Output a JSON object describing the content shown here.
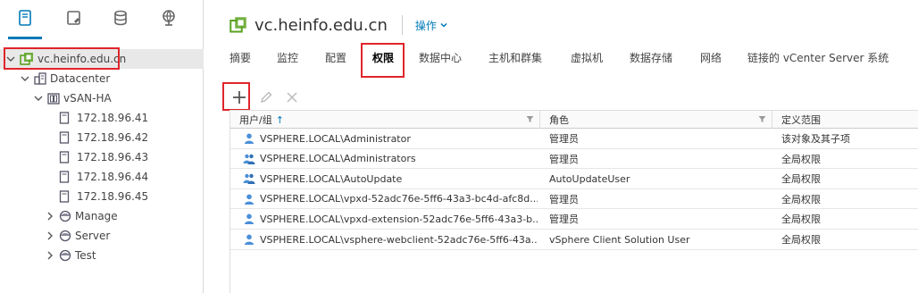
{
  "left_tabs": [
    {
      "name": "hosts-and-clusters-icon"
    },
    {
      "name": "vms-and-templates-icon"
    },
    {
      "name": "storage-icon"
    },
    {
      "name": "networking-icon"
    }
  ],
  "tree": {
    "root": "vc.heinfo.edu.cn",
    "datacenter": "Datacenter",
    "cluster": "vSAN-HA",
    "hosts": [
      "172.18.96.41",
      "172.18.96.42",
      "172.18.96.43",
      "172.18.96.44",
      "172.18.96.45"
    ],
    "vapps": [
      "Manage",
      "Server",
      "Test"
    ]
  },
  "header": {
    "title": "vc.heinfo.edu.cn",
    "actions_label": "操作"
  },
  "tabs": [
    "摘要",
    "监控",
    "配置",
    "权限",
    "数据中心",
    "主机和群集",
    "虚拟机",
    "数据存储",
    "网络",
    "链接的 vCenter Server 系统"
  ],
  "active_tab": "权限",
  "toolbar": {
    "add_icon": "plus-icon",
    "edit_icon": "pencil-icon",
    "delete_icon": "close-icon"
  },
  "grid": {
    "columns": [
      "用户/组",
      "角色",
      "定义范围"
    ],
    "sort_indicator": "↑",
    "rows": [
      {
        "user": "VSPHERE.LOCAL\\Administrator",
        "role": "管理员",
        "scope": "该对象及其子项",
        "type": "user"
      },
      {
        "user": "VSPHERE.LOCAL\\Administrators",
        "role": "管理员",
        "scope": "全局权限",
        "type": "group"
      },
      {
        "user": "VSPHERE.LOCAL\\AutoUpdate",
        "role": "AutoUpdateUser",
        "scope": "全局权限",
        "type": "group"
      },
      {
        "user": "VSPHERE.LOCAL\\vpxd-52adc76e-5ff6-43a3-bc4d-afc8d...",
        "role": "管理员",
        "scope": "全局权限",
        "type": "user"
      },
      {
        "user": "VSPHERE.LOCAL\\vpxd-extension-52adc76e-5ff6-43a3-b...",
        "role": "管理员",
        "scope": "全局权限",
        "type": "user"
      },
      {
        "user": "VSPHERE.LOCAL\\vsphere-webclient-52adc76e-5ff6-43a...",
        "role": "vSphere Client Solution User",
        "scope": "全局权限",
        "type": "user"
      }
    ]
  },
  "colors": {
    "accent": "#0079b8",
    "highlight": "#e0252b",
    "vc_green": "#5aa220"
  }
}
